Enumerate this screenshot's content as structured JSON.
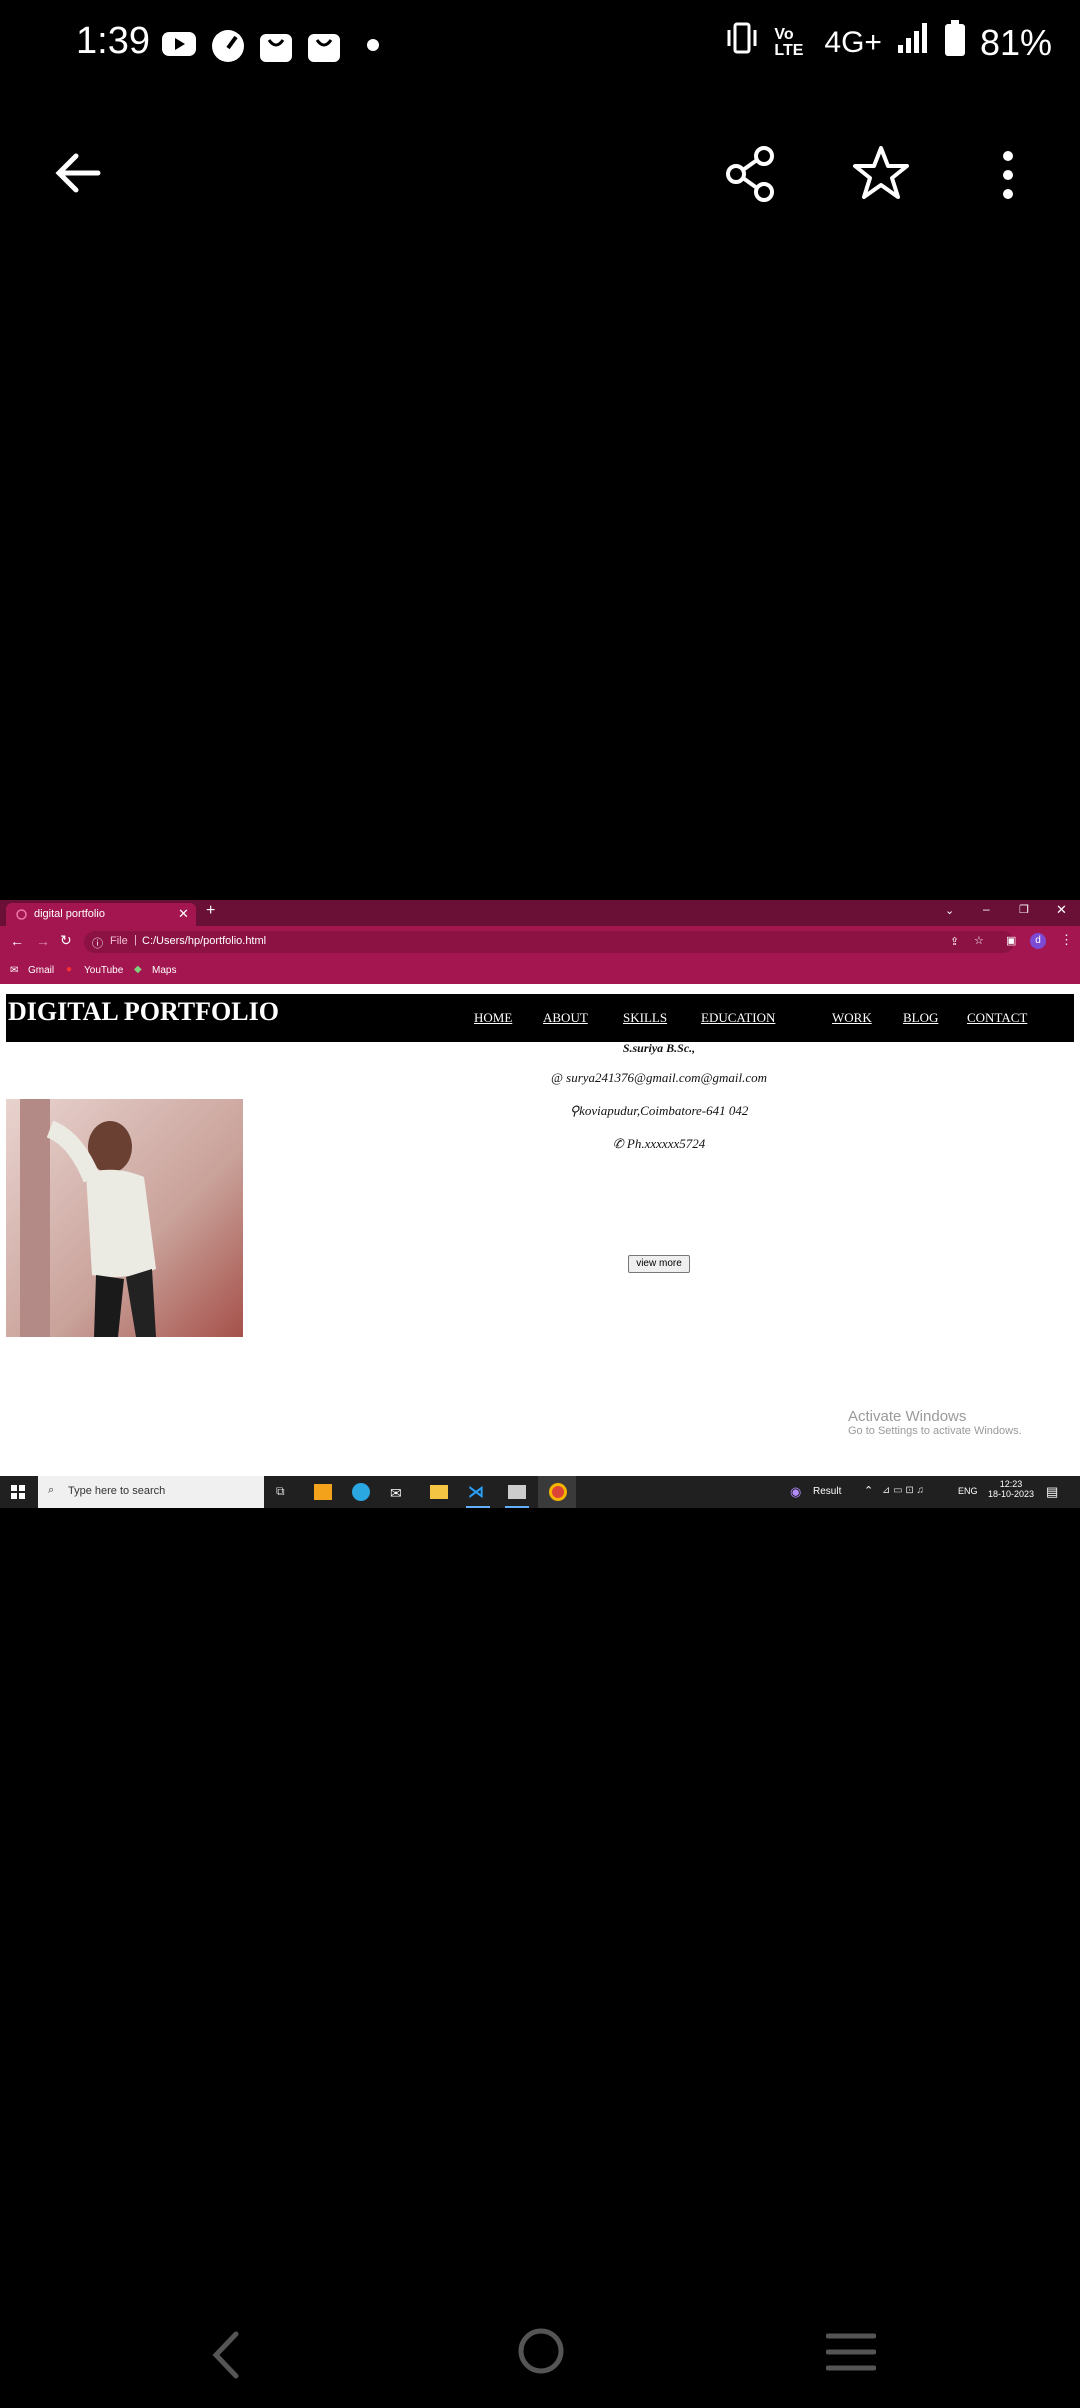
{
  "status_bar": {
    "time": "1:39",
    "network": "4G+",
    "volte": "Vo LTE",
    "battery": "81%"
  },
  "viewer_toolbar": {
    "back_icon": "arrow-left-icon",
    "share_icon": "share-icon",
    "favorite_icon": "star-icon",
    "more_icon": "more-vert-icon"
  },
  "browser": {
    "tab_title": "digital portfolio",
    "address_prefix": "File",
    "address": "C:/Users/hp/portfolio.html",
    "profile_initial": "d",
    "bookmarks": [
      "Gmail",
      "YouTube",
      "Maps"
    ]
  },
  "portfolio": {
    "brand": "DIGITAL PORTFOLIO",
    "nav": [
      "HOME",
      "ABOUT",
      "SKILLS",
      "EDUCATION",
      "WORK",
      "BLOG",
      "CONTACT"
    ],
    "name": "S.suriya B.Sc.,",
    "email": "surya241376@gmail.com@gmail.com",
    "location": "koviapudur,Coimbatore-641 042",
    "phone": "Ph.xxxxxx5724",
    "view_more": "view more"
  },
  "watermark": {
    "title": "Activate Windows",
    "subtitle": "Go to Settings to activate Windows."
  },
  "taskbar": {
    "search_placeholder": "Type here to search",
    "result_label": "Result",
    "lang": "ENG",
    "time": "12:23",
    "date": "18-10-2023"
  }
}
